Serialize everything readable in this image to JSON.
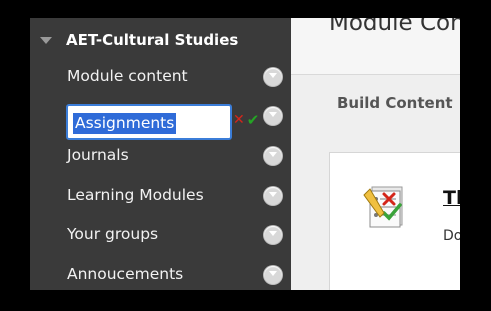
{
  "sidebar": {
    "course_title": "AET-Cultural Studies",
    "items": [
      {
        "label": "Module content"
      },
      {
        "label": "Assignments",
        "editing": true
      },
      {
        "label": "Journals"
      },
      {
        "label": "Learning Modules"
      },
      {
        "label": "Your groups"
      },
      {
        "label": "Annoucements"
      }
    ]
  },
  "main": {
    "page_title": "Module Con",
    "build_content": "Build Content",
    "content_item": {
      "title": "Th",
      "description": "Do"
    }
  },
  "colors": {
    "sidebar_bg": "#3a3a3a",
    "selection": "#2f6bd8",
    "cancel": "#d4261a",
    "confirm": "#25a425"
  },
  "icons": {
    "expand": "triangle-down-icon",
    "menu": "chevron-down-icon",
    "cancel": "x-icon",
    "confirm": "checkmark-icon",
    "content": "assignment-checklist-icon"
  }
}
